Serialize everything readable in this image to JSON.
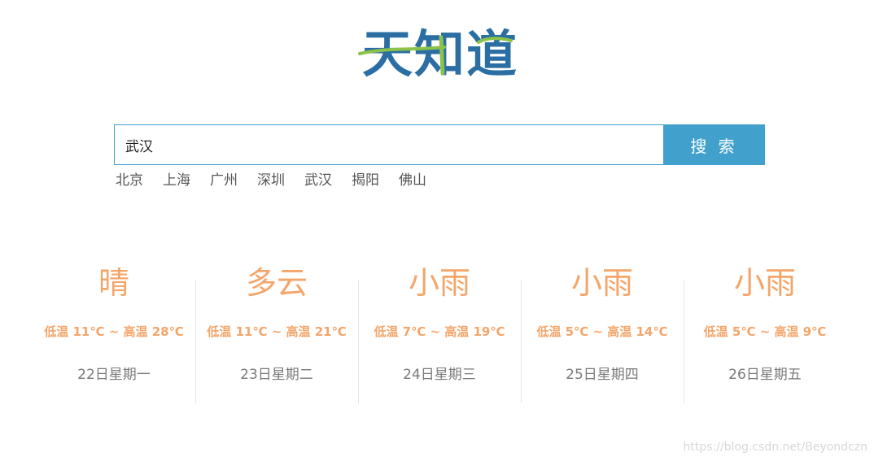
{
  "logo": {
    "text": "天知道",
    "colors": {
      "primary": "#2b6ea3",
      "accent": "#8bc34a"
    }
  },
  "search": {
    "value": "武汉",
    "button_label": "搜 索"
  },
  "quick_cities": [
    "北京",
    "上海",
    "广州",
    "深圳",
    "武汉",
    "揭阳",
    "佛山"
  ],
  "forecast": [
    {
      "weather": "晴",
      "temp": "低温 11℃ ~ 高温 28℃",
      "date": "22日星期一"
    },
    {
      "weather": "多云",
      "temp": "低温 11℃ ~ 高温 21℃",
      "date": "23日星期二"
    },
    {
      "weather": "小雨",
      "temp": "低温 7℃ ~ 高温 19℃",
      "date": "24日星期三"
    },
    {
      "weather": "小雨",
      "temp": "低温 5℃ ~ 高温 14℃",
      "date": "25日星期四"
    },
    {
      "weather": "小雨",
      "temp": "低温 5℃ ~ 高温 9℃",
      "date": "26日星期五"
    }
  ],
  "watermark": "https://blog.csdn.net/Beyondczn",
  "colors": {
    "accent_blue": "#41a1cc",
    "weather_orange": "#f4a56a",
    "date_gray": "#7a7a7a"
  }
}
